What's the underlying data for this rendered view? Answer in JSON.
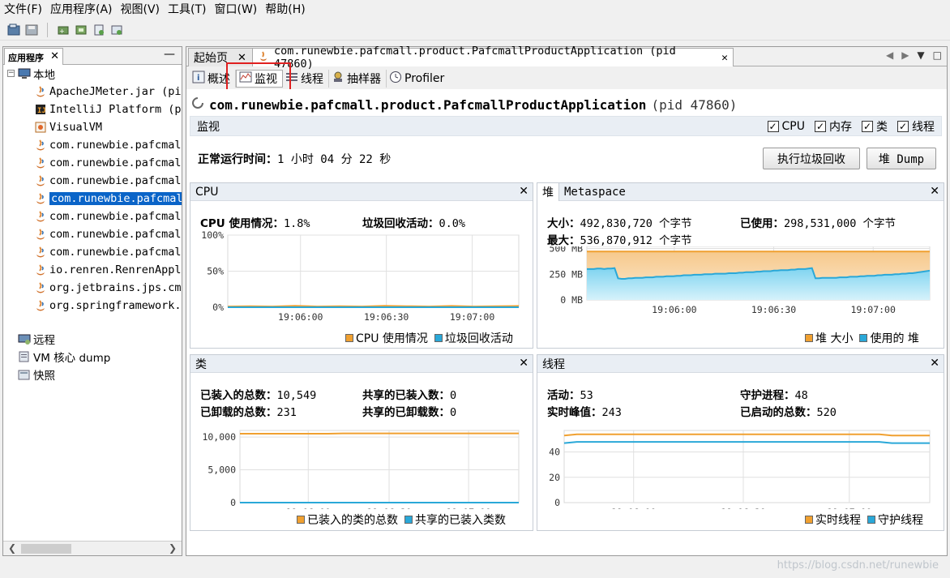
{
  "menubar": [
    "文件(F)",
    "应用程序(A)",
    "视图(V)",
    "工具(T)",
    "窗口(W)",
    "帮助(H)"
  ],
  "left_panel": {
    "tab_label": "应用程序",
    "tree": {
      "local": "本地",
      "items": [
        "ApacheJMeter.jar (pid",
        "IntelliJ Platform (p",
        "VisualVM",
        "com.runewbie.pafcmall",
        "com.runewbie.pafcmall",
        "com.runewbie.pafcmall",
        "com.runewbie.pafcmall",
        "com.runewbie.pafcmall",
        "com.runewbie.pafcmall",
        "com.runewbie.pafcmall",
        "io.renren.RenrenAppli",
        "org.jetbrains.jps.cmd",
        "org.springframework.b"
      ],
      "remote": "远程",
      "coredump": "VM 核心 dump",
      "snapshots": "快照"
    }
  },
  "doc_tabs": {
    "start": "起始页",
    "app": "com.runewbie.pafcmall.product.PafcmallProductApplication (pid 47860)"
  },
  "sub_tabs": [
    "概述",
    "监视",
    "线程",
    "抽样器",
    "Profiler"
  ],
  "app_title": {
    "name": "com.runewbie.pafcmall.product.PafcmallProductApplication",
    "pid": "(pid 47860)"
  },
  "monitor": {
    "label": "监视",
    "checks": [
      "CPU",
      "内存",
      "类",
      "线程"
    ]
  },
  "uptime": {
    "label": "正常运行时间：",
    "value": "1 小时 04 分 22 秒"
  },
  "buttons": {
    "gc": "执行垃圾回收",
    "heap_dump": "堆 Dump"
  },
  "cpu_panel": {
    "title": "CPU",
    "usage_label": "CPU 使用情况：",
    "usage_value": "1.8%",
    "gc_label": "垃圾回收活动：",
    "gc_value": "0.0%",
    "legend": [
      "CPU 使用情况",
      "垃圾回收活动"
    ]
  },
  "heap_panel": {
    "tabs": [
      "堆",
      "Metaspace"
    ],
    "size_label": "大小：",
    "size_value": "492,830,720 个字节",
    "used_label": "已使用：",
    "used_value": "298,531,000 个字节",
    "max_label": "最大：",
    "max_value": "536,870,912 个字节",
    "legend": [
      "堆 大小",
      "使用的 堆"
    ]
  },
  "classes_panel": {
    "title": "类",
    "loaded_label": "已装入的总数：",
    "loaded_value": "10,549",
    "unloaded_label": "已卸载的总数：",
    "unloaded_value": "231",
    "shared_loaded_label": "共享的已装入数：",
    "shared_loaded_value": "0",
    "shared_unloaded_label": "共享的已卸载数：",
    "shared_unloaded_value": "0",
    "legend": [
      "已装入的类的总数",
      "共享的已装入类数"
    ]
  },
  "threads_panel": {
    "title": "线程",
    "live_label": "活动：",
    "live_value": "53",
    "daemon_label": "守护进程：",
    "daemon_value": "48",
    "peak_label": "实时峰值：",
    "peak_value": "243",
    "started_label": "已启动的总数：",
    "started_value": "520",
    "legend": [
      "实时线程",
      "守护线程"
    ]
  },
  "colors": {
    "orange": "#f0a030",
    "blue": "#2aa8d8",
    "selection": "#0a64c8",
    "highlight": "#e02020"
  },
  "watermark": "https://blog.csdn.net/runewbie",
  "chart_data": [
    {
      "type": "line",
      "name": "cpu",
      "x_ticks": [
        "19:06:00",
        "19:06:30",
        "19:07:00"
      ],
      "y_ticks": [
        "100%",
        "50%",
        "0%"
      ],
      "ylim": [
        0,
        100
      ],
      "series": [
        {
          "name": "CPU 使用情况",
          "color": "#f0a030",
          "values": [
            1,
            1.5,
            1,
            2,
            1,
            1.5,
            1,
            2,
            1.5,
            1,
            1.8,
            1,
            1.5,
            1.8
          ]
        },
        {
          "name": "垃圾回收活动",
          "color": "#2aa8d8",
          "values": [
            0,
            0,
            0,
            0,
            0,
            0,
            0,
            0,
            0,
            0,
            0,
            0,
            0,
            0
          ]
        }
      ]
    },
    {
      "type": "area",
      "name": "heap",
      "x_ticks": [
        "19:06:00",
        "19:06:30",
        "19:07:00"
      ],
      "y_ticks": [
        "500 MB",
        "250 MB",
        "0 MB"
      ],
      "ylim": [
        0,
        520
      ],
      "series": [
        {
          "name": "堆 大小",
          "color": "#f0a030",
          "values": [
            470,
            470,
            470,
            470,
            470,
            470,
            470,
            470,
            470,
            470,
            470,
            470,
            470,
            470,
            470,
            470,
            470,
            470,
            470,
            470,
            470,
            470,
            470,
            470,
            470,
            470,
            470,
            470,
            470,
            470,
            470,
            470,
            470,
            470,
            470,
            470,
            470,
            470,
            470,
            470,
            470,
            470,
            470,
            470,
            470,
            470,
            470,
            470,
            470,
            470,
            470,
            470,
            470,
            470,
            470,
            470,
            470,
            470,
            470,
            470,
            470,
            470,
            470,
            470,
            470,
            470,
            470,
            470,
            470,
            470,
            470,
            470,
            470,
            470,
            470,
            470,
            470,
            470,
            470,
            470,
            470,
            470,
            470,
            470,
            470,
            470,
            470,
            470,
            470,
            470,
            470,
            470,
            470,
            470,
            470,
            470,
            470,
            470,
            470,
            470
          ]
        },
        {
          "name": "使用的 堆",
          "color": "#2aa8d8",
          "values": [
            300,
            300,
            300,
            305,
            305,
            300,
            305,
            305,
            310,
            210,
            205,
            205,
            210,
            210,
            215,
            215,
            215,
            220,
            220,
            220,
            225,
            225,
            225,
            230,
            230,
            230,
            235,
            235,
            240,
            240,
            240,
            245,
            245,
            245,
            250,
            250,
            250,
            255,
            255,
            255,
            255,
            260,
            260,
            260,
            265,
            265,
            270,
            270,
            270,
            275,
            275,
            280,
            280,
            280,
            285,
            285,
            290,
            290,
            290,
            295,
            295,
            300,
            300,
            300,
            305,
            310,
            210,
            210,
            215,
            215,
            215,
            215,
            215,
            220,
            220,
            220,
            225,
            225,
            225,
            230,
            230,
            235,
            235,
            235,
            240,
            240,
            245,
            245,
            245,
            250,
            250,
            255,
            255,
            260,
            260,
            265,
            270,
            275,
            280,
            285
          ]
        }
      ]
    },
    {
      "type": "line",
      "name": "classes",
      "x_ticks": [
        "19:06:00",
        "19:06:30",
        "19:07:00"
      ],
      "y_ticks": [
        "10,000",
        "5,000",
        "0"
      ],
      "ylim": [
        0,
        11000
      ],
      "series": [
        {
          "name": "已装入的类的总数",
          "color": "#f0a030",
          "values": [
            10500,
            10500,
            10500,
            10500,
            10500,
            10500,
            10500,
            10549,
            10549,
            10549,
            10549,
            10549,
            10549,
            10549,
            10549,
            10549,
            10549,
            10549,
            10549,
            10549
          ]
        },
        {
          "name": "共享的已装入类数",
          "color": "#2aa8d8",
          "values": [
            0,
            0,
            0,
            0,
            0,
            0,
            0,
            0,
            0,
            0,
            0,
            0,
            0,
            0,
            0,
            0,
            0,
            0,
            0,
            0
          ]
        }
      ]
    },
    {
      "type": "line",
      "name": "threads",
      "x_ticks": [
        "19:06:00",
        "19:06:30",
        "19:07:00"
      ],
      "y_ticks": [
        "40",
        "20",
        "0"
      ],
      "ylim": [
        0,
        57
      ],
      "series": [
        {
          "name": "实时线程",
          "color": "#f0a030",
          "values": [
            53,
            54,
            54,
            54,
            54,
            54,
            54,
            54,
            54,
            54,
            54,
            54,
            54,
            54,
            54,
            54,
            54,
            54,
            54,
            54,
            54,
            54,
            54,
            54,
            54,
            54,
            53,
            53,
            53,
            53
          ]
        },
        {
          "name": "守护线程",
          "color": "#2aa8d8",
          "values": [
            47,
            48,
            48,
            48,
            48,
            48,
            48,
            48,
            48,
            48,
            48,
            48,
            48,
            48,
            48,
            48,
            48,
            48,
            48,
            48,
            48,
            48,
            48,
            48,
            48,
            48,
            47,
            47,
            47,
            47
          ]
        }
      ]
    }
  ]
}
